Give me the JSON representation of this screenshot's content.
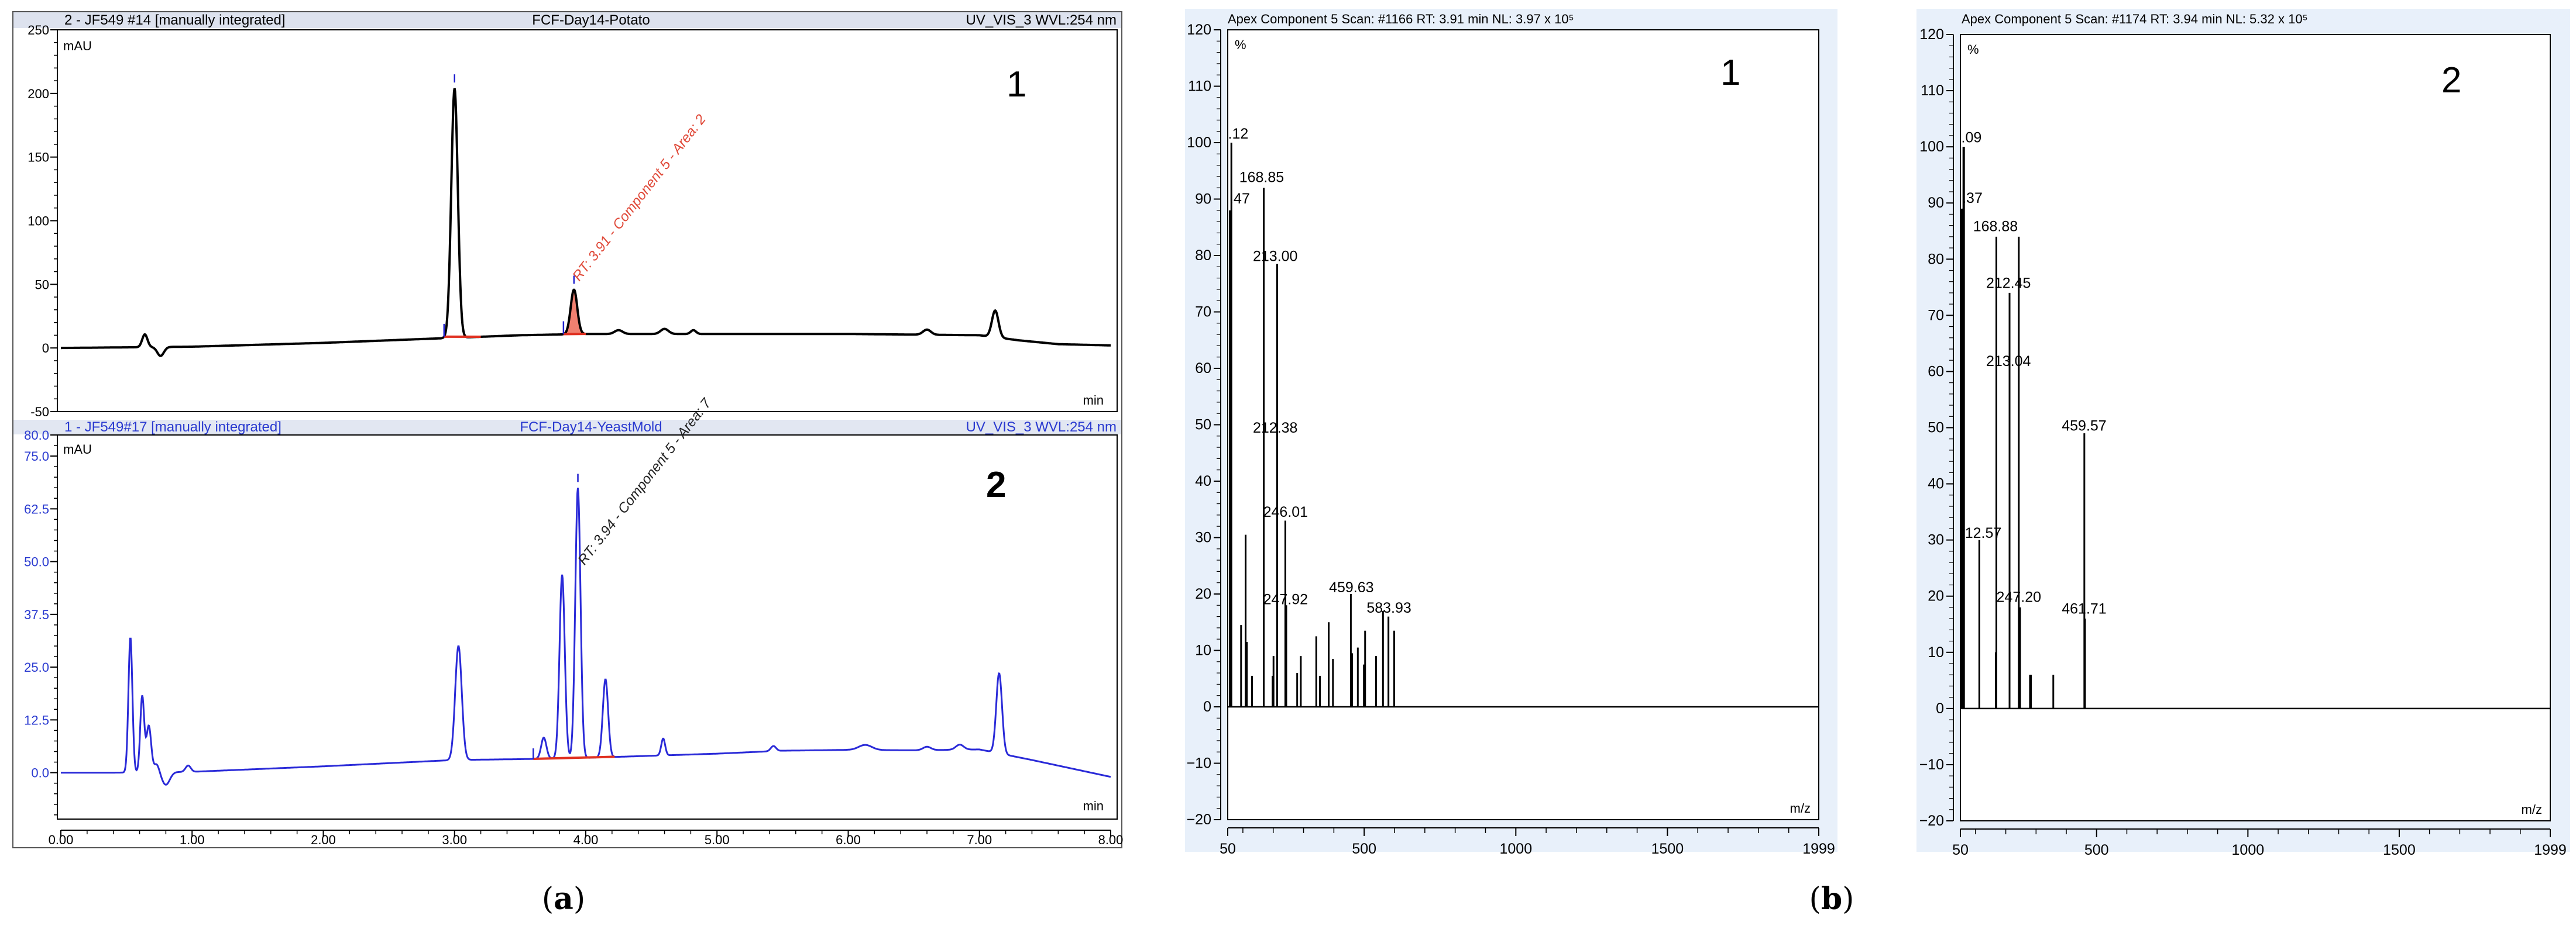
{
  "panel_a": {
    "caption_open": "(",
    "caption_letter": "a",
    "caption_close": ")"
  },
  "panel_b": {
    "caption_open": "(",
    "caption_letter": "b",
    "caption_close": ")"
  },
  "colors": {
    "trace1": "#000000",
    "trace2": "#2a2ad8",
    "integration": "#e03020",
    "peak_fill": "#f08070",
    "marker": "#2020d0",
    "header_bg": "#dde2ee",
    "spectrum_bg": "#e8f0fa"
  },
  "chart_data": [
    {
      "type": "line",
      "title": "FCF-Day14-Potato",
      "header_left": "2 - JF549 #14 [manually integrated]",
      "header_right": "UV_VIS_3 WVL:254 nm",
      "panel_number": "1",
      "ylabel": "mAU",
      "xlabel": "min",
      "xlim": [
        0,
        8
      ],
      "ylim": [
        -50,
        250
      ],
      "yticks": [
        "250",
        "200",
        "150",
        "100",
        "50",
        "0",
        "-50"
      ],
      "ytick_values": [
        250,
        200,
        150,
        100,
        50,
        0,
        -50
      ],
      "annotation": "RT: 3.91 - Component 5 - Area: 2",
      "baseline": [
        [
          0,
          0
        ],
        [
          0.5,
          0.5
        ],
        [
          1,
          1
        ],
        [
          2,
          4
        ],
        [
          3,
          8
        ],
        [
          3.5,
          10
        ],
        [
          4,
          11
        ],
        [
          5,
          11
        ],
        [
          6,
          11
        ],
        [
          7,
          10
        ],
        [
          7.3,
          6
        ],
        [
          7.6,
          3
        ],
        [
          8,
          2
        ]
      ],
      "peaks": [
        [
          0.64,
          10,
          0.02
        ],
        [
          0.76,
          -7,
          0.025
        ],
        [
          3.0,
          196,
          0.025
        ],
        [
          3.91,
          35,
          0.025
        ],
        [
          4.25,
          3,
          0.03
        ],
        [
          4.6,
          4,
          0.03
        ],
        [
          4.82,
          3,
          0.02
        ],
        [
          6.6,
          4,
          0.03
        ],
        [
          7.12,
          21,
          0.025
        ]
      ],
      "integrated_peak": {
        "rt": 3.91,
        "start": 3.83,
        "end": 4.0
      }
    },
    {
      "type": "line",
      "title": "FCF-Day14-YeastMold",
      "header_left": "1 - JF549#17 [manually integrated]",
      "header_right": "UV_VIS_3 WVL:254 nm",
      "panel_number": "2",
      "ylabel": "mAU",
      "xlabel": "min",
      "xlim": [
        0,
        8
      ],
      "ylim": [
        -11,
        80
      ],
      "yticks": [
        "80.0",
        "75.0",
        "62.5",
        "50.0",
        "37.5",
        "25.0",
        "12.5",
        "0.0"
      ],
      "ytick_values": [
        80,
        75,
        62.5,
        50,
        37.5,
        25,
        12.5,
        0
      ],
      "xticks": [
        "0.00",
        "1.00",
        "2.00",
        "3.00",
        "4.00",
        "5.00",
        "6.00",
        "7.00",
        "8.00"
      ],
      "annotation": "RT: 3.94 - Component 5 - Area: 7",
      "baseline": [
        [
          0,
          0
        ],
        [
          0.4,
          0
        ],
        [
          1,
          0.2
        ],
        [
          2,
          1.5
        ],
        [
          3,
          3
        ],
        [
          3.5,
          3.2
        ],
        [
          4,
          3.5
        ],
        [
          4.5,
          4
        ],
        [
          5,
          4.5
        ],
        [
          5.5,
          5.2
        ],
        [
          6,
          5.4
        ],
        [
          6.5,
          5.3
        ],
        [
          7,
          5.5
        ],
        [
          7.4,
          3
        ],
        [
          7.7,
          1
        ],
        [
          8,
          -1
        ]
      ],
      "peaks": [
        [
          0.53,
          32,
          0.015
        ],
        [
          0.62,
          18,
          0.015
        ],
        [
          0.67,
          11,
          0.018
        ],
        [
          0.73,
          2,
          0.02
        ],
        [
          0.8,
          -3,
          0.03
        ],
        [
          0.97,
          1.5,
          0.02
        ],
        [
          3.03,
          27,
          0.025
        ],
        [
          3.68,
          5,
          0.02
        ],
        [
          3.82,
          43.5,
          0.02
        ],
        [
          3.94,
          64,
          0.02
        ],
        [
          4.15,
          18.5,
          0.02
        ],
        [
          4.59,
          4,
          0.015
        ],
        [
          5.43,
          1.2,
          0.02
        ],
        [
          6.13,
          1.2,
          0.05
        ],
        [
          6.6,
          0.8,
          0.03
        ],
        [
          6.85,
          1.2,
          0.03
        ],
        [
          7.15,
          19,
          0.022
        ]
      ],
      "integrated_peak": {
        "rt": 3.94,
        "start": 3.6,
        "end": 4.22
      }
    },
    {
      "type": "bar",
      "title": "Apex Component 5 Scan: #1166  RT: 3.91 min NL: 3.97 x 10⁵",
      "panel_number": "1",
      "ylabel": "%",
      "xlabel": "m/z",
      "xlim": [
        50,
        1999
      ],
      "ylim": [
        -20,
        120
      ],
      "yticks": [
        "120",
        "110",
        "100",
        "90",
        "80",
        "70",
        "60",
        "50",
        "40",
        "30",
        "20",
        "10",
        "0",
        "−10",
        "−20"
      ],
      "xticks": [
        "50",
        "500",
        "1000",
        "1500",
        "1999"
      ],
      "sticks": [
        [
          57,
          88
        ],
        [
          62,
          100
        ],
        [
          94,
          14.5
        ],
        [
          109,
          30.5
        ],
        [
          113,
          11.5
        ],
        [
          130,
          5.5
        ],
        [
          168.85,
          92
        ],
        [
          198,
          5.5
        ],
        [
          201,
          9
        ],
        [
          213.0,
          78.5
        ],
        [
          240,
          33
        ],
        [
          243,
          18
        ],
        [
          279,
          6
        ],
        [
          291,
          9
        ],
        [
          342,
          12.5
        ],
        [
          354,
          5.5
        ],
        [
          383,
          15
        ],
        [
          397,
          8.5
        ],
        [
          456,
          20
        ],
        [
          460,
          9.5
        ],
        [
          479,
          10.5
        ],
        [
          499,
          7.5
        ],
        [
          503,
          13.5
        ],
        [
          539,
          9
        ],
        [
          562,
          17
        ],
        [
          580,
          16
        ],
        [
          599,
          13.5
        ]
      ],
      "labels": [
        {
          "text": ".12",
          "mz": 51,
          "pct": 100.7
        },
        {
          "text": ".47",
          "mz": 56,
          "pct": 89.2
        },
        {
          "text": "168.85",
          "mz": 88,
          "pct": 93
        },
        {
          "text": "213.00",
          "mz": 133,
          "pct": 79
        },
        {
          "text": "212.38",
          "mz": 133,
          "pct": 48.6
        },
        {
          "text": "246.01",
          "mz": 167,
          "pct": 33.7
        },
        {
          "text": "247.92",
          "mz": 167,
          "pct": 18.2
        },
        {
          "text": "459.63",
          "mz": 384,
          "pct": 20.3
        },
        {
          "text": "583.93",
          "mz": 508,
          "pct": 16.7
        }
      ]
    },
    {
      "type": "bar",
      "title": "Apex Component 5 Scan: #1174  RT: 3.94 min NL: 5.32 x 10⁵",
      "panel_number": "2",
      "ylabel": "%",
      "xlabel": "m/z",
      "xlim": [
        50,
        1999
      ],
      "ylim": [
        -20,
        120
      ],
      "yticks": [
        "120",
        "110",
        "100",
        "90",
        "80",
        "70",
        "60",
        "50",
        "40",
        "30",
        "20",
        "10",
        "0",
        "−10",
        "−20"
      ],
      "xticks": [
        "50",
        "500",
        "1000",
        "1500",
        "1999"
      ],
      "sticks": [
        [
          54,
          89
        ],
        [
          58,
          89
        ],
        [
          60,
          100
        ],
        [
          62,
          100
        ],
        [
          112.57,
          30
        ],
        [
          167,
          10
        ],
        [
          168.88,
          84
        ],
        [
          212.45,
          74
        ],
        [
          243,
          84
        ],
        [
          247.2,
          18
        ],
        [
          280,
          6
        ],
        [
          283,
          6
        ],
        [
          357,
          6
        ],
        [
          459.57,
          49
        ],
        [
          461.71,
          16
        ]
      ],
      "labels": [
        {
          "text": ".09",
          "mz": 53,
          "pct": 100.8
        },
        {
          "text": ".37",
          "mz": 56,
          "pct": 90
        },
        {
          "text": "168.88",
          "mz": 92,
          "pct": 85
        },
        {
          "text": "212.45",
          "mz": 135,
          "pct": 74.9
        },
        {
          "text": "213.04",
          "mz": 135,
          "pct": 61
        },
        {
          "text": "459.57",
          "mz": 385,
          "pct": 49.5
        },
        {
          "text": "12.57",
          "mz": 65,
          "pct": 30.4
        },
        {
          "text": "247.20",
          "mz": 169,
          "pct": 19
        },
        {
          "text": "461.71",
          "mz": 385,
          "pct": 16.9
        }
      ]
    }
  ]
}
